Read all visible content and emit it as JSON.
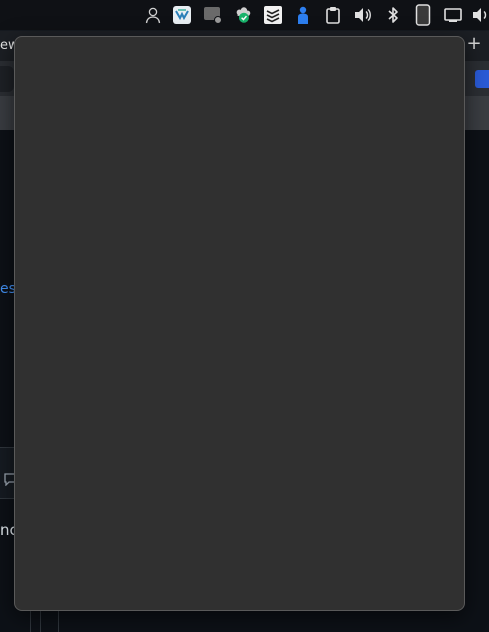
{
  "browser": {
    "tab_label_fragment": "ew",
    "new_tab_label": "+"
  },
  "page": {
    "link_fragment": "es",
    "text_fragment": "nc"
  },
  "tray": {
    "icons": [
      "user-account-icon",
      "vpn-shield-icon",
      "display-icon",
      "cloud-sync-check-icon",
      "todoist-icon",
      "person-status-icon",
      "clipboard-icon",
      "volume-icon",
      "bluetooth-icon",
      "phone-icon",
      "screen-cast-icon",
      "volume-icon-2"
    ]
  },
  "popup": {
    "state": "empty"
  }
}
